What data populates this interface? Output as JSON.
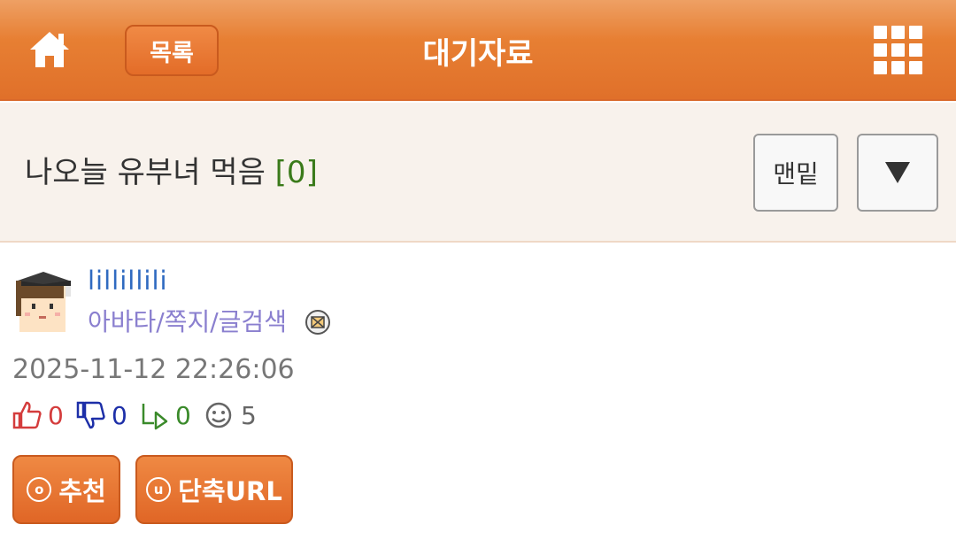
{
  "header": {
    "list_label": "목록",
    "title": "대기자료",
    "home_icon": "home-icon",
    "grid_icon": "grid-menu-icon"
  },
  "post": {
    "title": "나오늘 유부녀 먹음",
    "comment_count": "[0]",
    "bottom_label": "맨밑",
    "down_icon": "triangle-down-icon"
  },
  "author": {
    "name": "lillillili",
    "links": "아바타/쪽지/글검색",
    "avatar_icon": "graduate-avatar",
    "mail_icon": "mail-icon"
  },
  "datetime": "2025-11-12 22:26:06",
  "stats": {
    "likes": "0",
    "dislikes": "0",
    "replies": "0",
    "views": "5"
  },
  "actions": {
    "recommend_label": "추천",
    "recommend_letter": "o",
    "short_url_label": "단축URL",
    "short_url_letter": "u"
  },
  "colors": {
    "header_orange": "#e77f33",
    "like_red": "#d43c3c",
    "dislike_blue": "#1d2fa8",
    "reply_green": "#3a8a2a",
    "author_blue": "#2f6ac0",
    "links_purple": "#8a7fcf"
  }
}
